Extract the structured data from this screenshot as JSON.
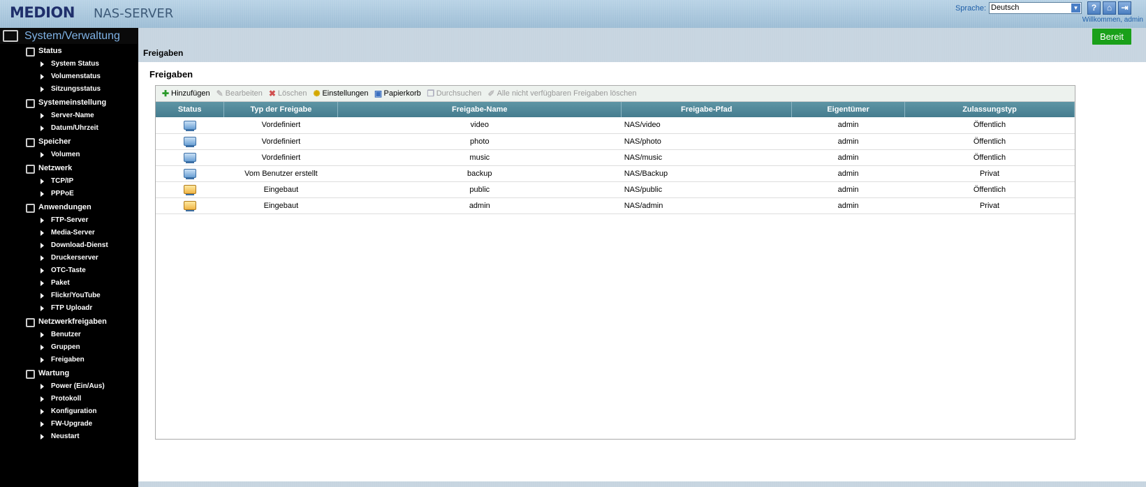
{
  "header": {
    "logo": "MEDION",
    "product": "NAS-SERVER",
    "language_label": "Sprache:",
    "language_value": "Deutsch",
    "welcome": "Willkommen, admin",
    "buttons": [
      {
        "name": "help-icon",
        "glyph": "?"
      },
      {
        "name": "home-icon",
        "glyph": "⌂"
      },
      {
        "name": "logout-icon",
        "glyph": "⇥"
      }
    ]
  },
  "sidebar": {
    "title": "System/Verwaltung",
    "sections": [
      {
        "label": "Status",
        "icon": "status-icon",
        "items": [
          "System Status",
          "Volumenstatus",
          "Sitzungsstatus"
        ]
      },
      {
        "label": "Systemeinstellung",
        "icon": "gear-icon",
        "items": [
          "Server-Name",
          "Datum/Uhrzeit"
        ]
      },
      {
        "label": "Speicher",
        "icon": "storage-icon",
        "items": [
          "Volumen"
        ]
      },
      {
        "label": "Netzwerk",
        "icon": "network-icon",
        "items": [
          "TCP/IP",
          "PPPoE"
        ]
      },
      {
        "label": "Anwendungen",
        "icon": "applications-icon",
        "items": [
          "FTP-Server",
          "Media-Server",
          "Download-Dienst",
          "Druckerserver",
          "OTC-Taste",
          "Paket",
          "Flickr/YouTube",
          "FTP Uploadr"
        ]
      },
      {
        "label": "Netzwerkfreigaben",
        "icon": "network-share-icon",
        "items": [
          "Benutzer",
          "Gruppen",
          "Freigaben"
        ]
      },
      {
        "label": "Wartung",
        "icon": "maintenance-icon",
        "items": [
          "Power (Ein/Aus)",
          "Protokoll",
          "Konfiguration",
          "FW-Upgrade",
          "Neustart"
        ]
      }
    ]
  },
  "main": {
    "status_button": "Bereit",
    "breadcrumb": "Freigaben",
    "panel_title": "Freigaben",
    "toolbar": [
      {
        "label": "Hinzufügen",
        "icon": "add-icon",
        "enabled": true
      },
      {
        "label": "Bearbeiten",
        "icon": "edit-icon",
        "enabled": false
      },
      {
        "label": "Löschen",
        "icon": "delete-icon",
        "enabled": false
      },
      {
        "label": "Einstellungen",
        "icon": "settings-icon",
        "enabled": true
      },
      {
        "label": "Papierkorb",
        "icon": "recycle-bin-icon",
        "enabled": true
      },
      {
        "label": "Durchsuchen",
        "icon": "browse-icon",
        "enabled": false
      },
      {
        "label": "Alle nicht verfügbaren Freigaben löschen",
        "icon": "clean-icon",
        "enabled": false
      }
    ],
    "columns": [
      "Status",
      "Typ der Freigabe",
      "Freigabe-Name",
      "Freigabe-Pfad",
      "Eigentümer",
      "Zulassungstyp"
    ],
    "rows": [
      {
        "status_icon": "folder-blue-icon",
        "type": "Vordefiniert",
        "name": "video",
        "path": "NAS/video",
        "owner": "admin",
        "access": "Öffentlich"
      },
      {
        "status_icon": "folder-blue-icon",
        "type": "Vordefiniert",
        "name": "photo",
        "path": "NAS/photo",
        "owner": "admin",
        "access": "Öffentlich"
      },
      {
        "status_icon": "folder-blue-icon",
        "type": "Vordefiniert",
        "name": "music",
        "path": "NAS/music",
        "owner": "admin",
        "access": "Öffentlich"
      },
      {
        "status_icon": "folder-blue-icon",
        "type": "Vom Benutzer erstellt",
        "name": "backup",
        "path": "NAS/Backup",
        "owner": "admin",
        "access": "Privat"
      },
      {
        "status_icon": "folder-yellow-icon",
        "type": "Eingebaut",
        "name": "public",
        "path": "NAS/public",
        "owner": "admin",
        "access": "Öffentlich"
      },
      {
        "status_icon": "folder-yellow-icon",
        "type": "Eingebaut",
        "name": "admin",
        "path": "NAS/admin",
        "owner": "admin",
        "access": "Privat"
      }
    ]
  }
}
